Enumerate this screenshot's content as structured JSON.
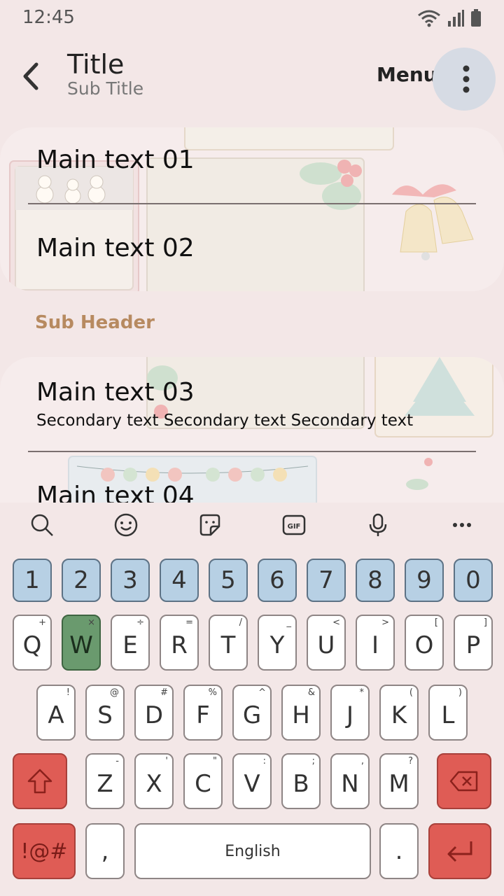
{
  "status": {
    "time": "12:45"
  },
  "appbar": {
    "title": "Title",
    "subtitle": "Sub Title",
    "menu_label": "Menu"
  },
  "list": {
    "items": [
      {
        "main": "Main text 01"
      },
      {
        "main": "Main text 02"
      },
      {
        "main": "Main text 03",
        "secondary": "Secondary text Secondary text Secondary text"
      },
      {
        "main": "Main text 04"
      }
    ],
    "subheader": "Sub Header"
  },
  "keyboard": {
    "numbers": [
      "1",
      "2",
      "3",
      "4",
      "5",
      "6",
      "7",
      "8",
      "9",
      "0"
    ],
    "row1": [
      {
        "key": "Q",
        "sym": "+"
      },
      {
        "key": "W",
        "sym": "×"
      },
      {
        "key": "E",
        "sym": "÷"
      },
      {
        "key": "R",
        "sym": "="
      },
      {
        "key": "T",
        "sym": "/"
      },
      {
        "key": "Y",
        "sym": "_"
      },
      {
        "key": "U",
        "sym": "<"
      },
      {
        "key": "I",
        "sym": ">"
      },
      {
        "key": "O",
        "sym": "["
      },
      {
        "key": "P",
        "sym": "]"
      }
    ],
    "row2": [
      {
        "key": "A",
        "sym": "!"
      },
      {
        "key": "S",
        "sym": "@"
      },
      {
        "key": "D",
        "sym": "#"
      },
      {
        "key": "F",
        "sym": "%"
      },
      {
        "key": "G",
        "sym": "^"
      },
      {
        "key": "H",
        "sym": "&"
      },
      {
        "key": "J",
        "sym": "*"
      },
      {
        "key": "K",
        "sym": "("
      },
      {
        "key": "L",
        "sym": ")"
      }
    ],
    "row3": [
      {
        "key": "Z",
        "sym": "-"
      },
      {
        "key": "X",
        "sym": "'"
      },
      {
        "key": "C",
        "sym": "\""
      },
      {
        "key": "V",
        "sym": ":"
      },
      {
        "key": "B",
        "sym": ";"
      },
      {
        "key": "N",
        "sym": ","
      },
      {
        "key": "M",
        "sym": "?"
      }
    ],
    "symbols_label": "!@#",
    "comma": ",",
    "space_label": "English",
    "period": "."
  },
  "colors": {
    "background": "#f3e7e7",
    "number_key": "#b7d0e4",
    "accent_red": "#df5c55",
    "highlight_green": "#6a9a6e",
    "subheader": "#b78a60"
  },
  "icons": [
    "back-arrow-icon",
    "more-vert-icon",
    "wifi-icon",
    "signal-icon",
    "battery-icon",
    "search-icon",
    "emoji-icon",
    "sticker-icon",
    "gif-icon",
    "mic-icon",
    "more-horiz-icon",
    "shift-icon",
    "backspace-icon",
    "enter-icon"
  ]
}
